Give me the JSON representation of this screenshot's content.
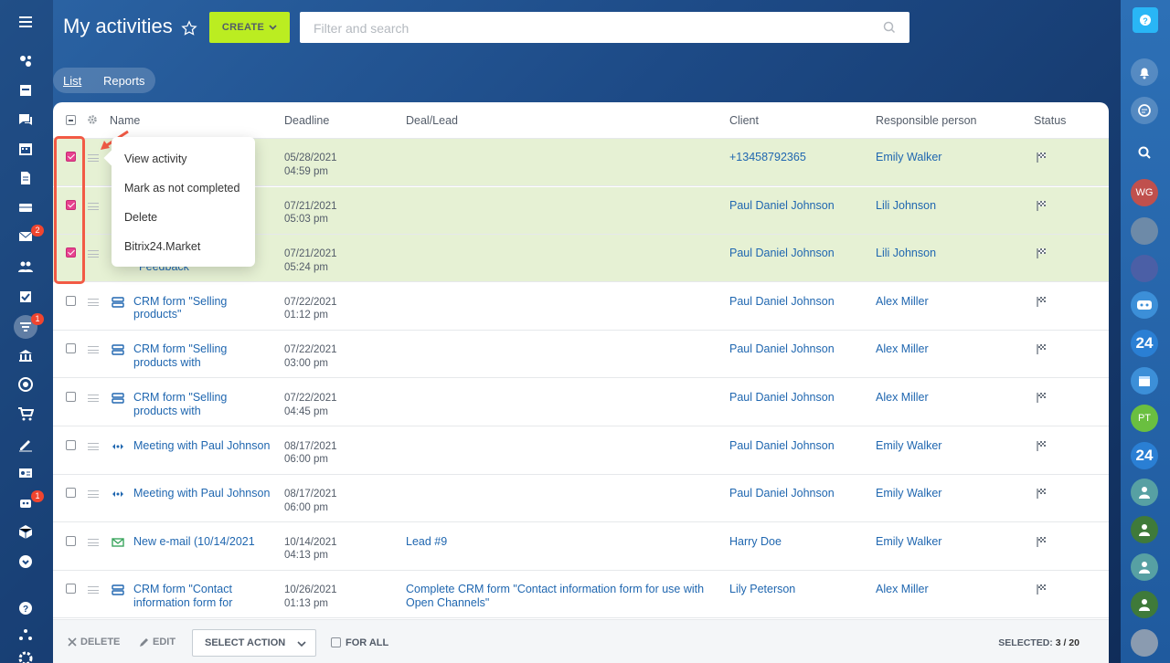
{
  "header": {
    "title": "My activities",
    "create_label": "CREATE",
    "search_placeholder": "Filter and search"
  },
  "tabs": [
    {
      "label": "List"
    },
    {
      "label": "Reports"
    }
  ],
  "columns": {
    "name": "Name",
    "deadline": "Deadline",
    "deal": "Deal/Lead",
    "client": "Client",
    "responsible": "Responsible person",
    "status": "Status"
  },
  "rows": [
    {
      "name": "",
      "deadline_date": "05/28/2021",
      "deadline_time": "04:59 pm",
      "deal": "",
      "client": "+13458792365",
      "responsible": "Emily Walker",
      "selected": true,
      "icon": "none"
    },
    {
      "name": "",
      "deadline_date": "07/21/2021",
      "deadline_time": "05:03 pm",
      "deal": "",
      "client": "Paul Daniel Johnson",
      "responsible": "Lili Johnson",
      "selected": true,
      "icon": "none"
    },
    {
      "name": "Feedback",
      "deadline_date": "07/21/2021",
      "deadline_time": "05:24 pm",
      "deal": "",
      "client": "Paul Daniel Johnson",
      "responsible": "Lili Johnson",
      "selected": true,
      "icon": "none"
    },
    {
      "name": "CRM form \"Selling products\"",
      "deadline_date": "07/22/2021",
      "deadline_time": "01:12 pm",
      "deal": "",
      "client": "Paul Daniel Johnson",
      "responsible": "Alex Miller",
      "selected": false,
      "icon": "form-icon"
    },
    {
      "name": "CRM form \"Selling products with",
      "deadline_date": "07/22/2021",
      "deadline_time": "03:00 pm",
      "deal": "",
      "client": "Paul Daniel Johnson",
      "responsible": "Alex Miller",
      "selected": false,
      "icon": "form-icon"
    },
    {
      "name": "CRM form \"Selling products with",
      "deadline_date": "07/22/2021",
      "deadline_time": "04:45 pm",
      "deal": "",
      "client": "Paul Daniel Johnson",
      "responsible": "Alex Miller",
      "selected": false,
      "icon": "form-icon"
    },
    {
      "name": "Meeting with Paul Johnson",
      "deadline_date": "08/17/2021",
      "deadline_time": "06:00 pm",
      "deal": "",
      "client": "Paul Daniel Johnson",
      "responsible": "Emily Walker",
      "selected": false,
      "icon": "meeting-icon"
    },
    {
      "name": "Meeting with Paul Johnson",
      "deadline_date": "08/17/2021",
      "deadline_time": "06:00 pm",
      "deal": "",
      "client": "Paul Daniel Johnson",
      "responsible": "Emily Walker",
      "selected": false,
      "icon": "meeting-icon"
    },
    {
      "name": "New e-mail (10/14/2021",
      "deadline_date": "10/14/2021",
      "deadline_time": "04:13 pm",
      "deal": "Lead #9",
      "client": "Harry Doe",
      "responsible": "Emily Walker",
      "selected": false,
      "icon": "email-icon"
    },
    {
      "name": "CRM form \"Contact information form for",
      "deadline_date": "10/26/2021",
      "deadline_time": "01:13 pm",
      "deal": "Complete CRM form \"Contact information form for use with Open Channels\"",
      "client": "Lily Peterson",
      "responsible": "Alex Miller",
      "selected": false,
      "icon": "form-icon"
    }
  ],
  "context_menu": [
    "View activity",
    "Mark as not completed",
    "Delete",
    "Bitrix24.Market"
  ],
  "footer": {
    "delete_label": "DELETE",
    "edit_label": "EDIT",
    "select_action_label": "SELECT ACTION",
    "for_all_label": "FOR ALL",
    "selected_label": "SELECTED:",
    "selected_value": "3 / 20"
  },
  "badges": {
    "mail": "2",
    "crm": "1",
    "robot": "1"
  },
  "right_avatars": {
    "wg": "WG",
    "pt": "PT",
    "b24": "24"
  },
  "colors": {
    "accent": "#bbed21",
    "link": "#2067b0",
    "selected_row": "#e6f1d4",
    "highlight": "#f25a45",
    "checkbox_on": "#e8428f"
  }
}
